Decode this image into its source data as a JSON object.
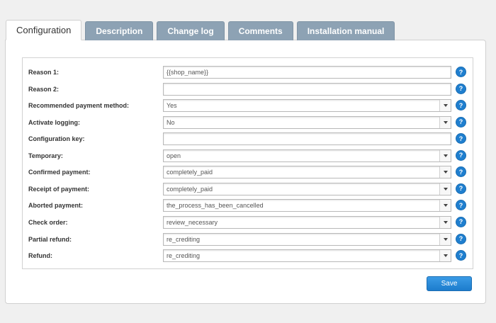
{
  "tabs": [
    {
      "label": "Configuration",
      "active": true
    },
    {
      "label": "Description",
      "active": false
    },
    {
      "label": "Change log",
      "active": false
    },
    {
      "label": "Comments",
      "active": false
    },
    {
      "label": "Installation manual",
      "active": false
    }
  ],
  "fields": [
    {
      "label": "Reason 1:",
      "type": "text",
      "value": "{{shop_name}}"
    },
    {
      "label": "Reason 2:",
      "type": "text",
      "value": ""
    },
    {
      "label": "Recommended payment method:",
      "type": "select",
      "value": "Yes"
    },
    {
      "label": "Activate logging:",
      "type": "select",
      "value": "No"
    },
    {
      "label": "Configuration key:",
      "type": "text",
      "value": ""
    },
    {
      "label": "Temporary:",
      "type": "select",
      "value": "open"
    },
    {
      "label": "Confirmed payment:",
      "type": "select",
      "value": "completely_paid"
    },
    {
      "label": "Receipt of payment:",
      "type": "select",
      "value": "completely_paid"
    },
    {
      "label": "Aborted payment:",
      "type": "select",
      "value": "the_process_has_been_cancelled"
    },
    {
      "label": "Check order:",
      "type": "select",
      "value": "review_necessary"
    },
    {
      "label": "Partial refund:",
      "type": "select",
      "value": "re_crediting"
    },
    {
      "label": "Refund:",
      "type": "select",
      "value": "re_crediting"
    }
  ],
  "help_glyph": "?",
  "save_label": "Save",
  "colors": {
    "accent": "#1f7fcf",
    "tab_inactive": "#8da2b4"
  }
}
